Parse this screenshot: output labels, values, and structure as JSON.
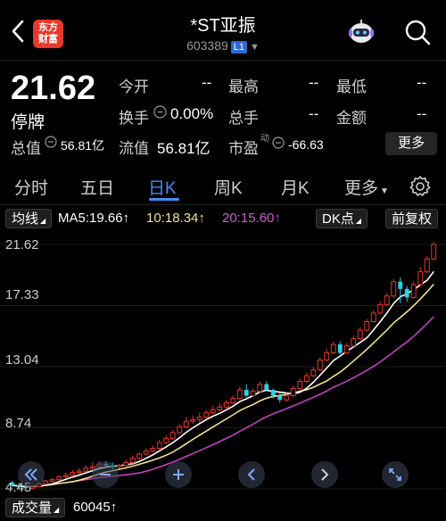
{
  "header": {
    "title": "*ST亚振",
    "code": "603389",
    "level_badge": "L1",
    "logo_text_line1": "东方",
    "logo_text_line2": "财富"
  },
  "quote": {
    "price": "21.62",
    "status": "停牌",
    "open_label": "今开",
    "open_value": "--",
    "high_label": "最高",
    "high_value": "--",
    "low_label": "最低",
    "low_value": "--",
    "turnover_label": "换手",
    "turnover_value": "0.00%",
    "volume_label": "总手",
    "volume_value": "--",
    "amount_label": "金额",
    "amount_value": "--",
    "total_cap_label": "总值",
    "total_cap_value": "56.81亿",
    "float_cap_label": "流值",
    "float_cap_value": "56.81亿",
    "pe_label": "市盈",
    "pe_sup": "动",
    "pe_value": "-66.63",
    "more_label": "更多"
  },
  "tabs": [
    "分时",
    "五日",
    "日K",
    "周K",
    "月K",
    "更多"
  ],
  "active_tab": "日K",
  "toolbar": {
    "indicator": "均线",
    "ma5": "MA5:19.66",
    "ma10": "10:18.34",
    "ma20": "20:15.60",
    "dk_label": "DK点",
    "adjust_label": "前复权"
  },
  "colors": {
    "up": "#e8382a",
    "down": "#29d3e6",
    "ma5": "#ffffff",
    "ma10": "#f2e18c",
    "ma20": "#c43fc2",
    "accent": "#3f8ff7"
  },
  "chart_data": {
    "type": "candlestick",
    "y_ticks": [
      "21.62",
      "17.33",
      "13.04",
      "8.74",
      "4.45"
    ],
    "ylim": [
      4.45,
      21.62
    ],
    "ma5_end": 19.66,
    "ma10_end": 18.34,
    "ma20_end": 15.6,
    "candles": [
      [
        4.9,
        4.7,
        5.0,
        4.6
      ],
      [
        4.7,
        4.6,
        4.9,
        4.5
      ],
      [
        4.6,
        4.5,
        4.8,
        4.4
      ],
      [
        4.5,
        4.6,
        4.7,
        4.45
      ],
      [
        4.6,
        4.8,
        4.9,
        4.55
      ],
      [
        4.8,
        5.0,
        5.1,
        4.7
      ],
      [
        5.0,
        5.1,
        5.2,
        4.9
      ],
      [
        5.1,
        5.3,
        5.4,
        5.0
      ],
      [
        5.3,
        5.4,
        5.6,
        5.2
      ],
      [
        5.4,
        5.6,
        5.8,
        5.3
      ],
      [
        5.6,
        5.7,
        5.9,
        5.5
      ],
      [
        5.7,
        5.9,
        6.1,
        5.6
      ],
      [
        5.9,
        6.0,
        6.3,
        5.8
      ],
      [
        6.0,
        6.2,
        6.4,
        5.9
      ],
      [
        6.2,
        6.1,
        6.4,
        6.0
      ],
      [
        6.1,
        6.0,
        6.3,
        5.8
      ],
      [
        6.0,
        6.1,
        6.2,
        5.9
      ],
      [
        6.1,
        6.3,
        6.5,
        6.0
      ],
      [
        6.3,
        6.6,
        6.8,
        6.2
      ],
      [
        6.6,
        6.9,
        7.0,
        6.5
      ],
      [
        6.9,
        7.1,
        7.3,
        6.8
      ],
      [
        7.1,
        7.3,
        7.5,
        7.0
      ],
      [
        7.3,
        7.7,
        7.9,
        7.2
      ],
      [
        7.7,
        8.0,
        8.2,
        7.6
      ],
      [
        8.0,
        8.4,
        8.6,
        7.9
      ],
      [
        8.4,
        8.8,
        9.0,
        8.3
      ],
      [
        8.8,
        9.2,
        9.5,
        8.7
      ],
      [
        9.2,
        9.3,
        9.6,
        9.0
      ],
      [
        9.3,
        9.5,
        9.8,
        9.1
      ],
      [
        9.5,
        9.8,
        10.0,
        9.4
      ],
      [
        9.8,
        10.0,
        10.3,
        9.7
      ],
      [
        10.0,
        10.2,
        10.5,
        9.9
      ],
      [
        10.2,
        10.5,
        10.7,
        10.0
      ],
      [
        10.5,
        10.8,
        11.0,
        10.4
      ],
      [
        10.8,
        11.4,
        11.6,
        10.7
      ],
      [
        11.4,
        11.0,
        11.8,
        10.9
      ],
      [
        11.0,
        11.3,
        11.5,
        10.9
      ],
      [
        11.3,
        11.8,
        12.0,
        11.2
      ],
      [
        11.8,
        11.4,
        12.0,
        11.3
      ],
      [
        11.4,
        11.0,
        11.5,
        10.8
      ],
      [
        11.0,
        10.7,
        11.2,
        10.5
      ],
      [
        10.7,
        11.0,
        11.2,
        10.6
      ],
      [
        11.0,
        11.5,
        11.7,
        10.9
      ],
      [
        11.5,
        12.0,
        12.2,
        11.4
      ],
      [
        12.0,
        12.4,
        12.6,
        11.9
      ],
      [
        12.4,
        12.8,
        13.0,
        12.3
      ],
      [
        12.8,
        13.5,
        13.7,
        12.7
      ],
      [
        13.5,
        14.0,
        14.3,
        13.4
      ],
      [
        14.0,
        14.6,
        14.8,
        13.9
      ],
      [
        14.6,
        14.0,
        14.8,
        13.9
      ],
      [
        14.0,
        14.5,
        14.7,
        13.9
      ],
      [
        14.5,
        15.0,
        15.2,
        14.4
      ],
      [
        15.0,
        15.6,
        15.8,
        14.9
      ],
      [
        15.6,
        16.2,
        16.4,
        15.5
      ],
      [
        16.2,
        16.8,
        17.0,
        16.1
      ],
      [
        16.8,
        17.4,
        17.6,
        16.7
      ],
      [
        17.4,
        18.0,
        18.2,
        17.3
      ],
      [
        18.0,
        19.0,
        19.2,
        17.9
      ],
      [
        19.0,
        18.5,
        19.3,
        17.5
      ],
      [
        18.5,
        17.9,
        18.7,
        17.6
      ],
      [
        17.9,
        18.8,
        19.0,
        17.8
      ],
      [
        18.8,
        19.7,
        20.0,
        18.7
      ],
      [
        19.7,
        20.6,
        20.8,
        19.6
      ],
      [
        20.6,
        21.62,
        21.8,
        20.5
      ]
    ]
  },
  "volume": {
    "label": "成交量",
    "value": "60045"
  }
}
